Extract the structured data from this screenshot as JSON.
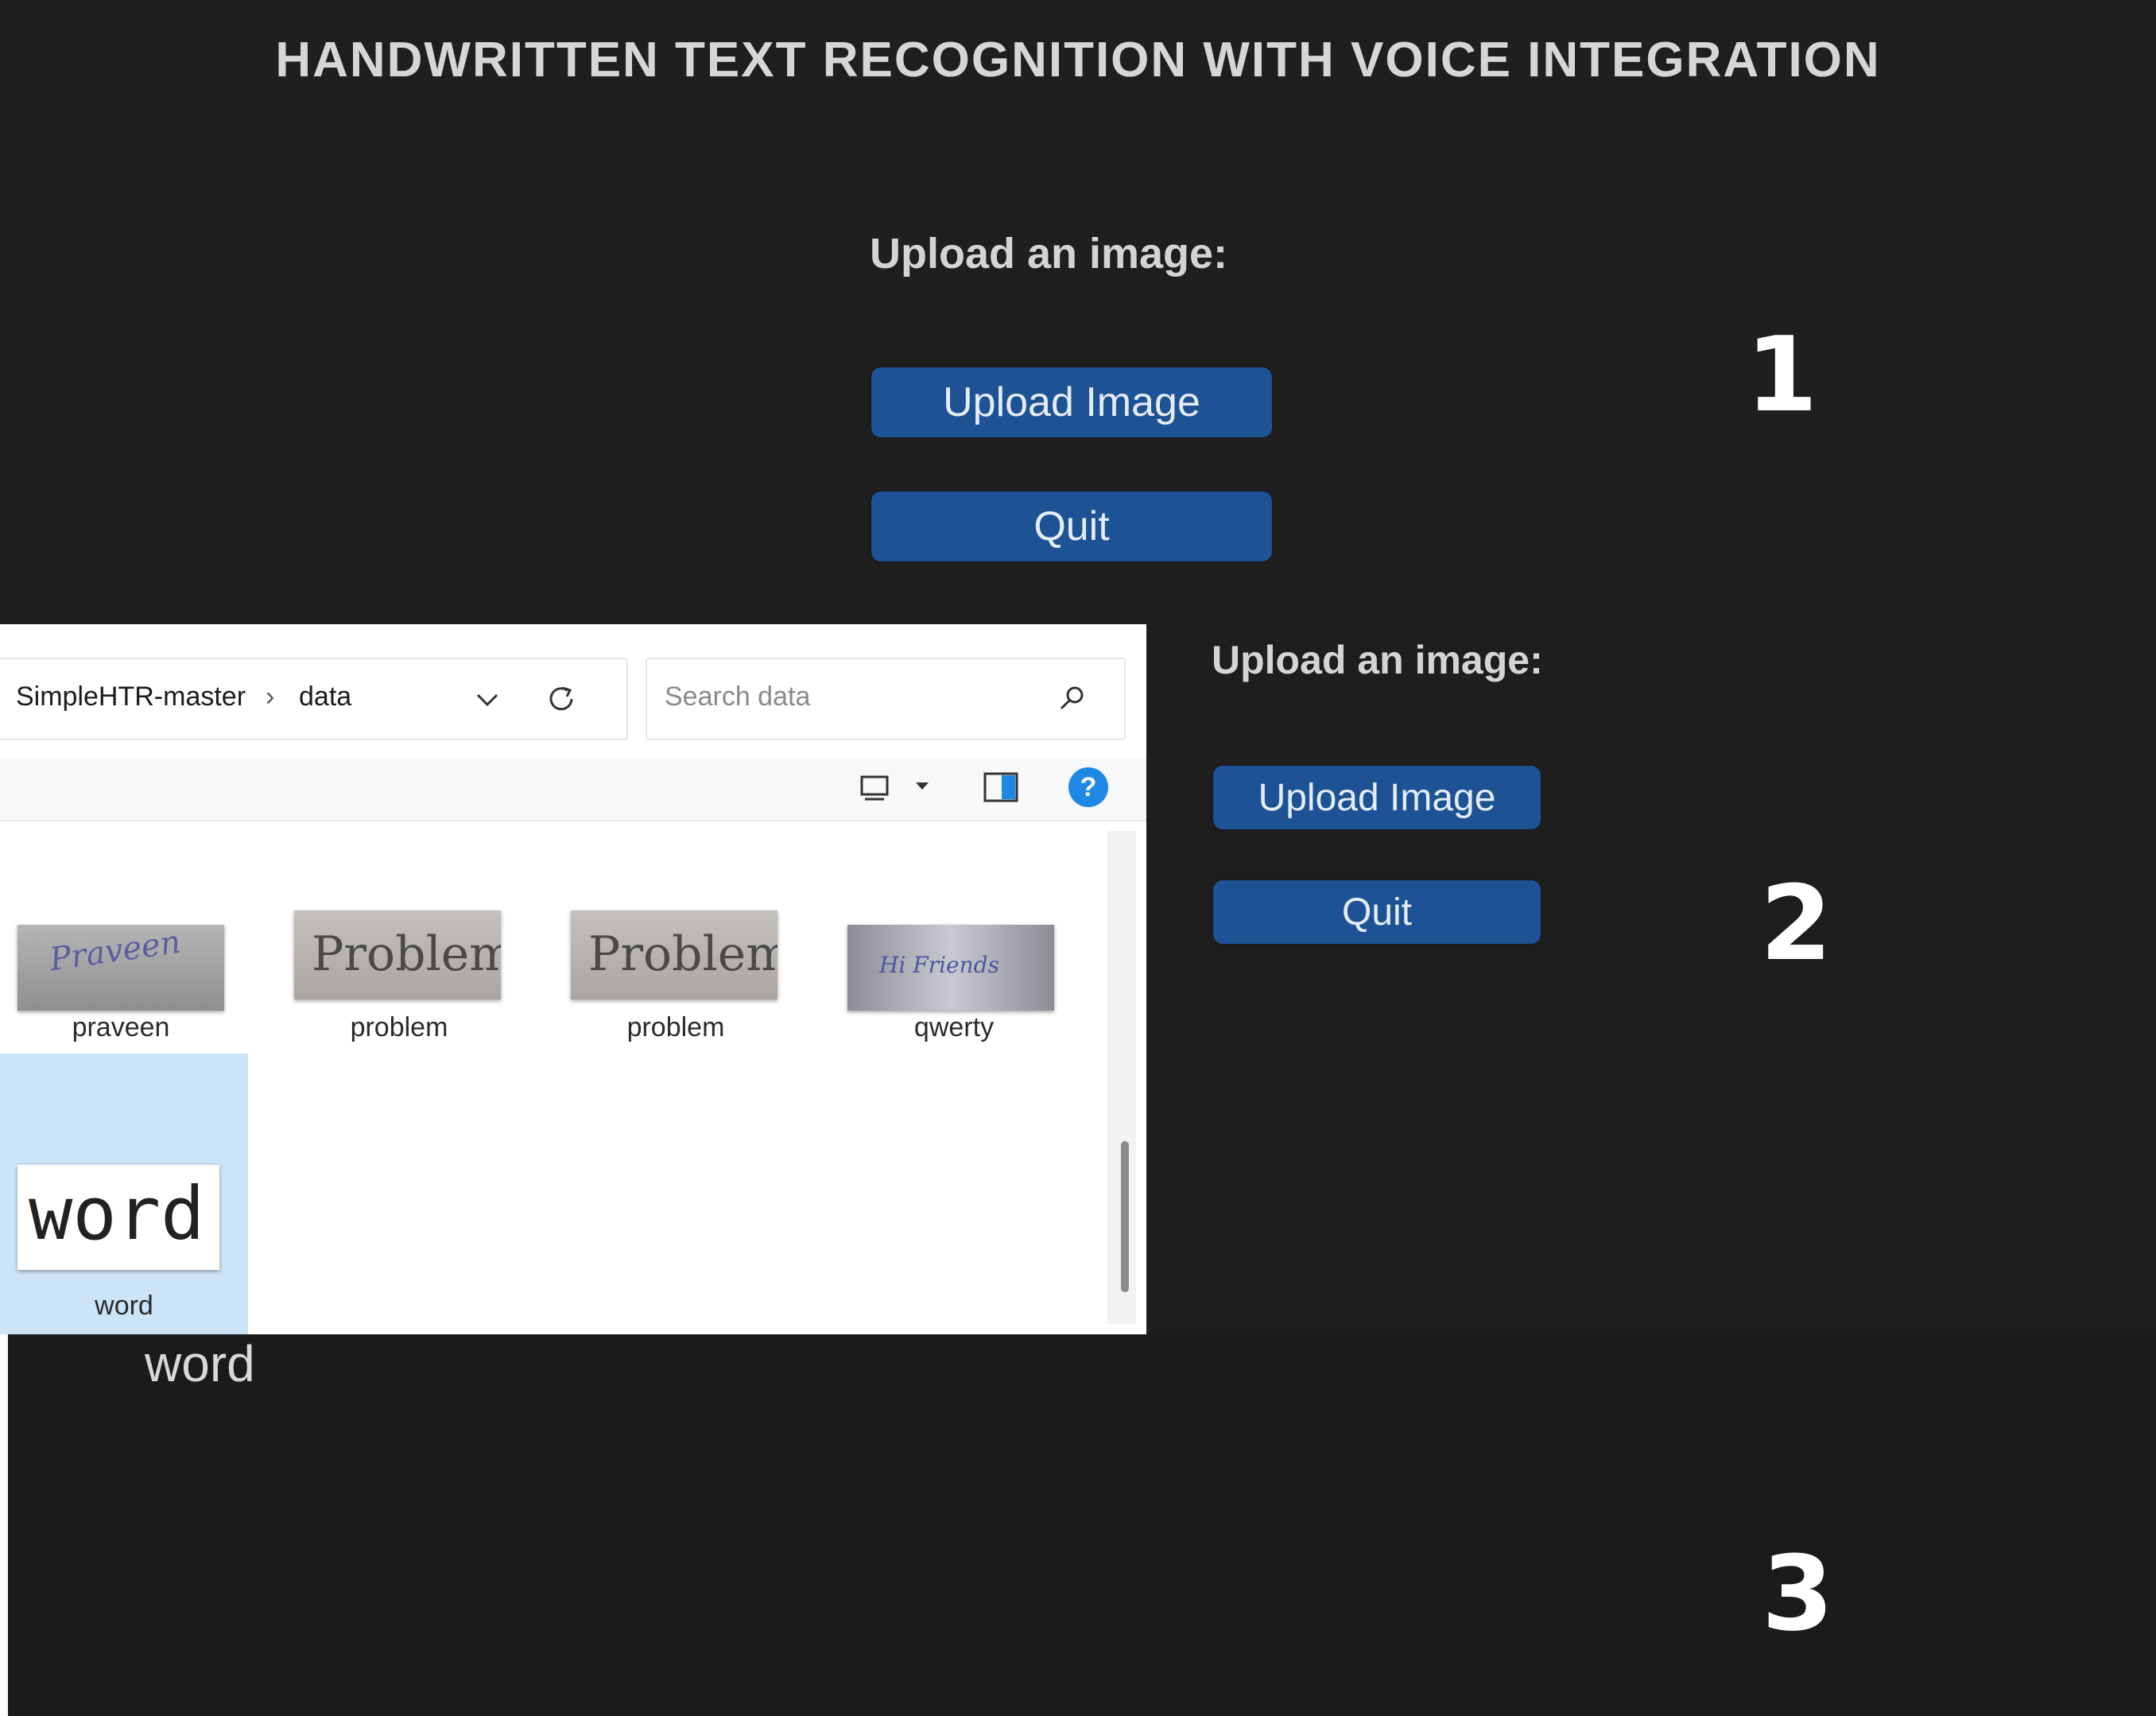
{
  "panel1": {
    "app_title": "HANDWRITTEN TEXT RECOGNITION WITH VOICE INTEGRATION",
    "prompt": "Upload an image:",
    "upload_button": "Upload Image",
    "quit_button": "Quit",
    "step_number": "1"
  },
  "panel2": {
    "prompt": "Upload an image:",
    "upload_button": "Upload Image",
    "quit_button": "Quit",
    "step_number": "2",
    "file_dialog": {
      "breadcrumb": [
        "SimpleHTR-master",
        "data"
      ],
      "breadcrumb_separator": "›",
      "search_placeholder": "Search data",
      "help_glyph": "?",
      "files": [
        {
          "name": "praveen",
          "thumbnail_text": "Praveen",
          "selected": false
        },
        {
          "name": "problem",
          "thumbnail_text": "Problem",
          "selected": false
        },
        {
          "name": "problem",
          "thumbnail_text": "Problem",
          "selected": false
        },
        {
          "name": "qwerty",
          "thumbnail_text": "Hi Friends",
          "selected": false
        },
        {
          "name": "word",
          "thumbnail_text": "word",
          "selected": true
        }
      ]
    }
  },
  "panel3": {
    "result_text": "word",
    "step_number": "3"
  },
  "colors": {
    "background_dark": "#1f1f1f",
    "button_blue": "#1d5394",
    "selection_blue": "#cce4f7",
    "help_icon_blue": "#1e88e5"
  }
}
